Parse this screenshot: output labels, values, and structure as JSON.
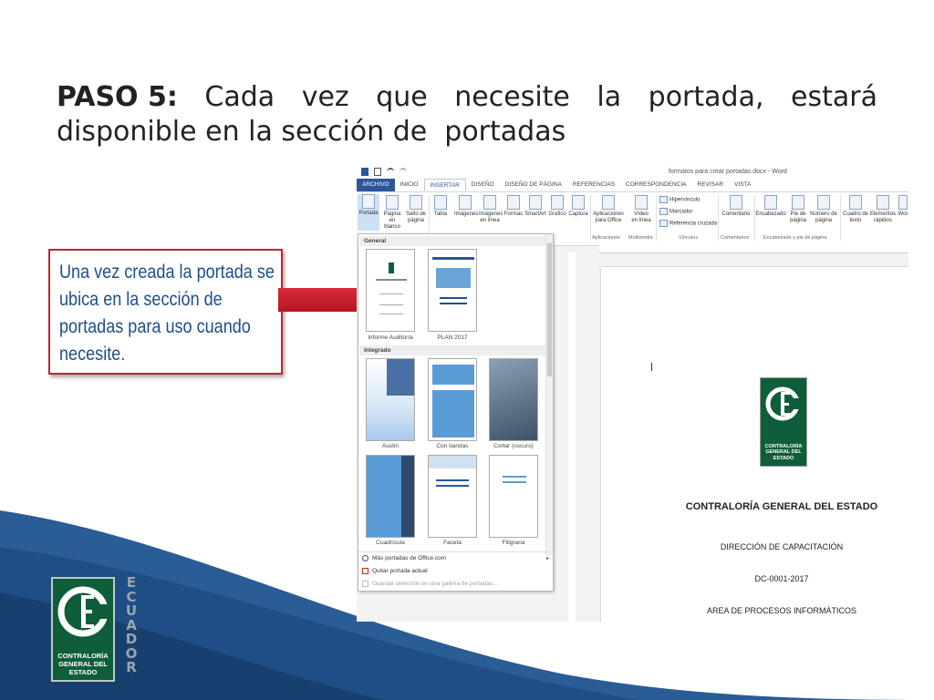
{
  "slide": {
    "title_step": "PASO 5:",
    "title_line1_words": [
      "Cada",
      "vez",
      "que",
      "necesite",
      "la",
      "portada,",
      "estará"
    ],
    "title_line2": "disponible en la sección de  portadas",
    "callout_text": "Una vez creada la portada se ubica en la sección de portadas para uso cuando necesite.",
    "logo_text": "CONTRALORÍA GENERAL DEL ESTADO",
    "country_letters": [
      "E",
      "C",
      "U",
      "A",
      "D",
      "O",
      "R"
    ],
    "colors": {
      "accent_blue": "#1e4e8c",
      "callout_border": "#c0272d",
      "arrow": "#c8102e",
      "logo_green": "#0f5e3a",
      "wave_blue": "#2a5c95"
    }
  },
  "word": {
    "window_title": "formatos para crear portadas.docx - Word",
    "tabs": [
      "ARCHIVO",
      "INICIO",
      "INSERTAR",
      "DISEÑO",
      "DISEÑO DE PÁGINA",
      "REFERENCIAS",
      "CORRESPONDENCIA",
      "REVISAR",
      "VISTA"
    ],
    "active_tab": "INSERTAR",
    "ribbon_buttons": [
      {
        "label": "Portada"
      },
      {
        "label": "Página en blanco"
      },
      {
        "label": "Salto de página"
      },
      {
        "label": "Tabla"
      },
      {
        "label": "Imágenes"
      },
      {
        "label": "Imágenes en línea"
      },
      {
        "label": "Formas"
      },
      {
        "label": "SmartArt"
      },
      {
        "label": "Gráfico"
      },
      {
        "label": "Captura"
      },
      {
        "label": "Aplicaciones para Office"
      },
      {
        "label": "Vídeo en línea"
      },
      {
        "label": "Comentario"
      },
      {
        "label": "Encabezado"
      },
      {
        "label": "Pie de página"
      },
      {
        "label": "Número de página"
      },
      {
        "label": "Cuadro de texto"
      },
      {
        "label": "Elementos rápidos"
      },
      {
        "label": "Wor"
      }
    ],
    "link_items": [
      "Hipervínculo",
      "Marcador",
      "Referencia cruzada"
    ],
    "group_labels": [
      "Aplicaciones",
      "Multimedia",
      "Vínculos",
      "Comentarios",
      "Encabezado y pie de página"
    ],
    "gallery": {
      "section_general": "General",
      "section_integrado": "Integrado",
      "general_items": [
        "Informe Auditoría",
        "PLAN 2017"
      ],
      "integrado_items": [
        "Austin",
        "Con bandas",
        "Cortar (oscuro)",
        "Cuadrícula",
        "Faceta",
        "Filigrana"
      ],
      "menu_more": "Más portadas de Office.com",
      "menu_remove": "Quitar portada actual",
      "menu_save": "Guardar selección en una galería de portadas..."
    },
    "document": {
      "org": "CONTRALORÍA GENERAL DEL ESTADO",
      "dept": "DIRECCIÓN DE CAPACITACIÓN",
      "code": "DC-0001-2017",
      "area": "AREA DE PROCESOS INFORMÁTICOS",
      "logo_text": "CONTRALORÍA GENERAL DEL ESTADO"
    }
  }
}
